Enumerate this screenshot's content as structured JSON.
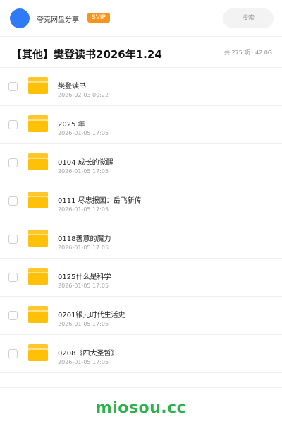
{
  "header": {
    "brand": "夸克网盘分享",
    "badge": "SVIP",
    "search_placeholder": "搜索"
  },
  "title_row": {
    "title": "【其他】樊登读书2026年1.24",
    "meta": "共 275 项 · 42.0G"
  },
  "items": [
    {
      "name": "樊登读书",
      "date": "2026-02-03 00:22"
    },
    {
      "name": "2025 年",
      "date": "2026-01-05 17:05"
    },
    {
      "name": "0104 成长的觉醒",
      "date": "2026-01-05 17:05"
    },
    {
      "name": "0111 尽忠报国：岳飞新传",
      "date": "2026-01-05 17:05"
    },
    {
      "name": "0118善意的魔力",
      "date": "2026-01-05 17:05"
    },
    {
      "name": "0125什么是科学",
      "date": "2026-01-05 17:05"
    },
    {
      "name": "0201银元时代生活史",
      "date": "2026-01-05 17:05"
    },
    {
      "name": "0208《四大圣哲》",
      "date": "2026-01-05 17:05"
    }
  ],
  "footer": {
    "logo": "miosou.cc"
  },
  "colors": {
    "accent": "#2f7bf6",
    "badge": "#f7941d",
    "folder": "#ffc107",
    "logo": "#2db24a"
  }
}
